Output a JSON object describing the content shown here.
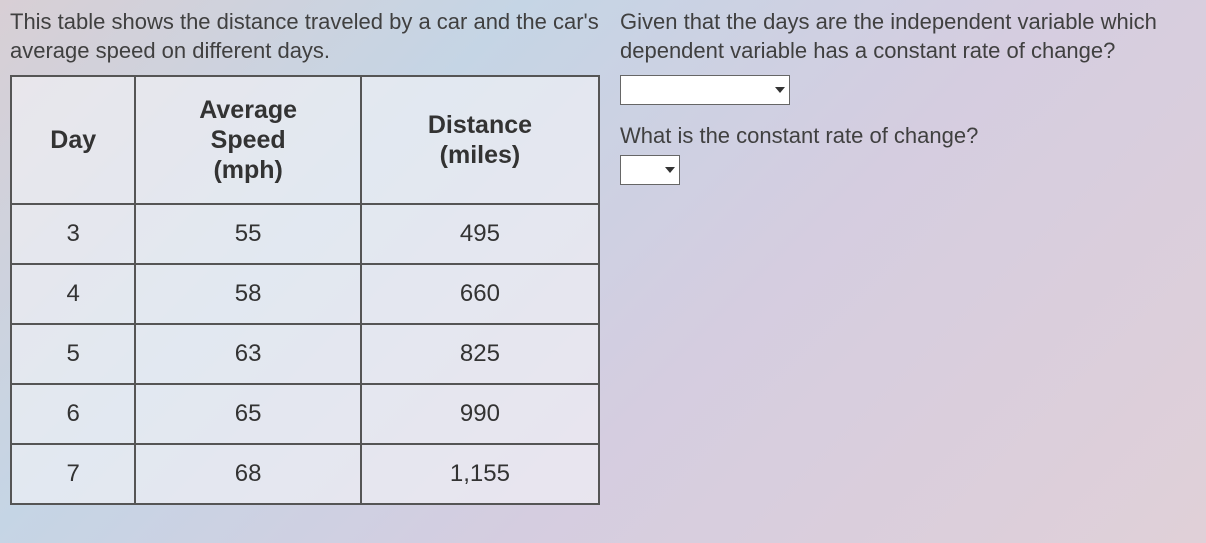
{
  "intro": "This table shows the distance traveled by a car and the car's average speed on different days.",
  "question1": "Given that the days are the independent variable which dependent variable has a constant rate of change?",
  "question2": "What is the constant rate of change?",
  "chart_data": {
    "type": "table",
    "headers": {
      "col1": "Day",
      "col2": "Average Speed (mph)",
      "col2_line1": "Average",
      "col2_line2": "Speed",
      "col2_line3": "(mph)",
      "col3": "Distance (miles)",
      "col3_line1": "Distance",
      "col3_line2": "(miles)"
    },
    "rows": [
      {
        "day": "3",
        "speed": "55",
        "distance": "495"
      },
      {
        "day": "4",
        "speed": "58",
        "distance": "660"
      },
      {
        "day": "5",
        "speed": "63",
        "distance": "825"
      },
      {
        "day": "6",
        "speed": "65",
        "distance": "990"
      },
      {
        "day": "7",
        "speed": "68",
        "distance": "1,155"
      }
    ]
  }
}
